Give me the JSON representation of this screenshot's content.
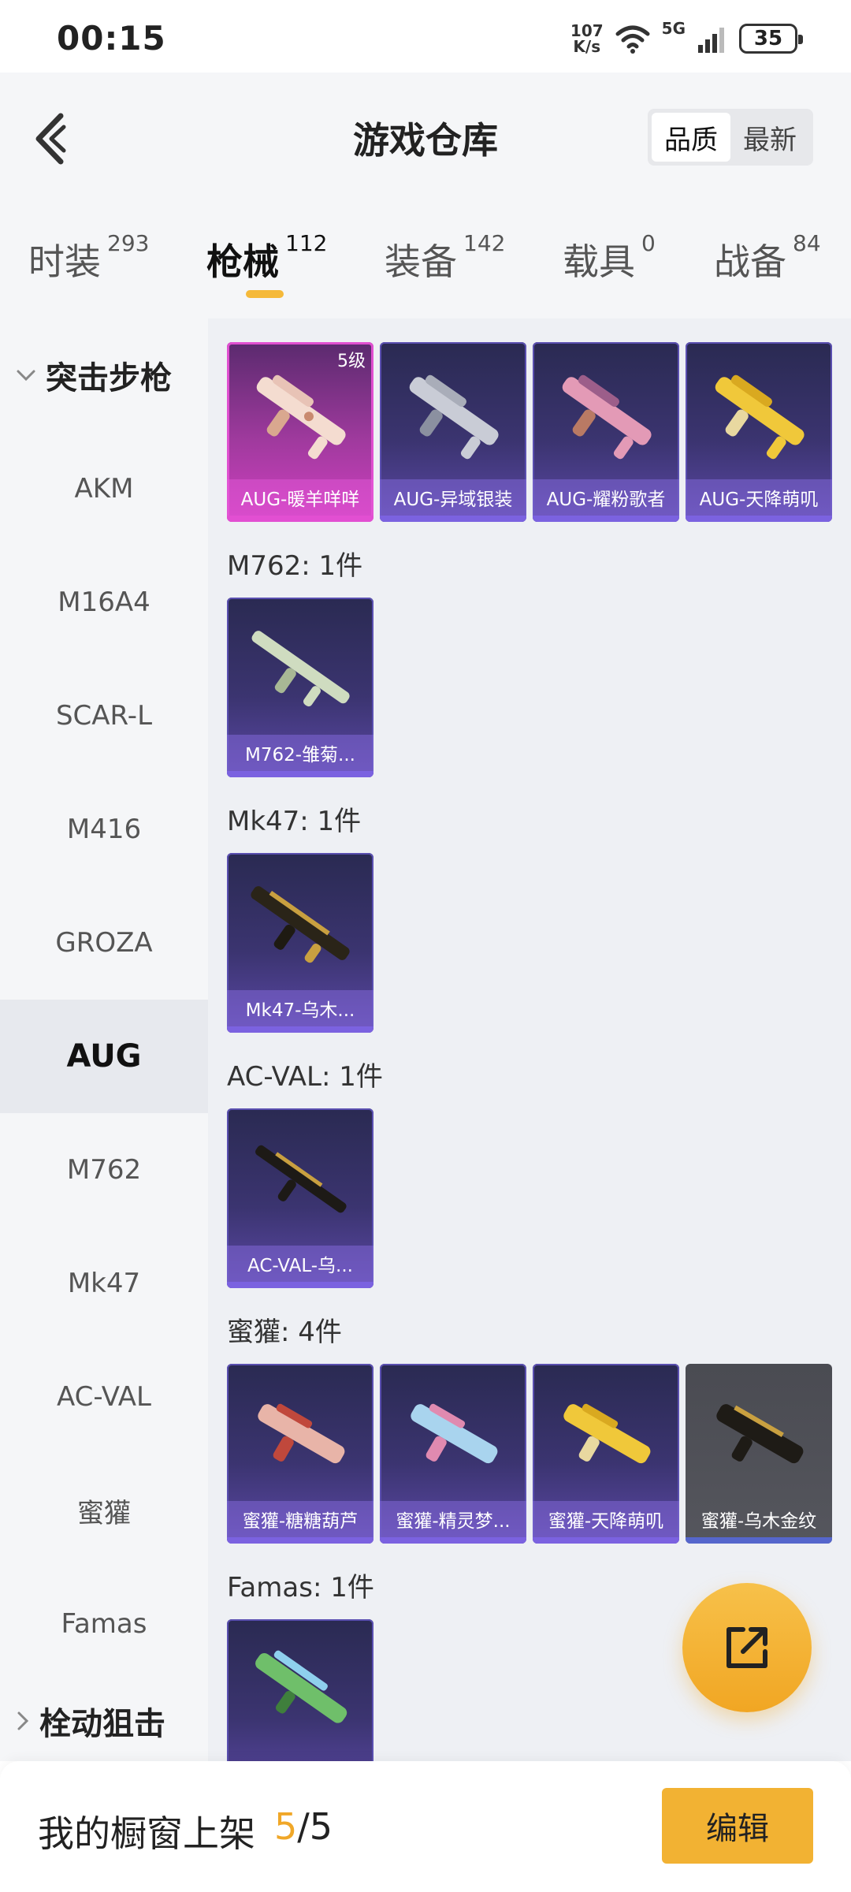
{
  "status": {
    "time": "00:15",
    "speed_value": "107",
    "speed_unit": "K/s",
    "network": "5G",
    "battery": "35"
  },
  "header": {
    "title": "游戏仓库",
    "sort_quality": "品质",
    "sort_newest": "最新"
  },
  "tabs": [
    {
      "label": "时装",
      "count": "293"
    },
    {
      "label": "枪械",
      "count": "112"
    },
    {
      "label": "装备",
      "count": "142"
    },
    {
      "label": "载具",
      "count": "0"
    },
    {
      "label": "战备",
      "count": "84"
    }
  ],
  "sidebar": {
    "group_assault": "突击步枪",
    "items": [
      "AKM",
      "M16A4",
      "SCAR-L",
      "M416",
      "GROZA",
      "AUG",
      "M762",
      "Mk47",
      "AC-VAL",
      "蜜獾",
      "Famas"
    ],
    "group_bolt": "栓动狙击"
  },
  "sections": {
    "aug": {
      "items": [
        "AUG-暖羊咩咩",
        "AUG-异域银装",
        "AUG-耀粉歌者",
        "AUG-天降萌叽"
      ],
      "level": "5级"
    },
    "m762": {
      "title": "M762: 1件",
      "items": [
        "M762-雏菊..."
      ]
    },
    "mk47": {
      "title": "Mk47: 1件",
      "items": [
        "Mk47-乌木..."
      ]
    },
    "acval": {
      "title": "AC-VAL: 1件",
      "items": [
        "AC-VAL-乌..."
      ]
    },
    "honeybadger": {
      "title": "蜜獾: 4件",
      "items": [
        "蜜獾-糖糖葫芦",
        "蜜獾-精灵梦...",
        "蜜獾-天降萌叽",
        "蜜獾-乌木金纹"
      ]
    },
    "famas": {
      "title": "Famas: 1件"
    }
  },
  "bottom": {
    "label": "我的橱窗上架",
    "current": "5",
    "separator": "/",
    "total": "5",
    "edit": "编辑"
  },
  "colors": {
    "accent": "#f2b233",
    "rare_purple": "#5b48a6",
    "rare_pink": "#d040c0"
  }
}
